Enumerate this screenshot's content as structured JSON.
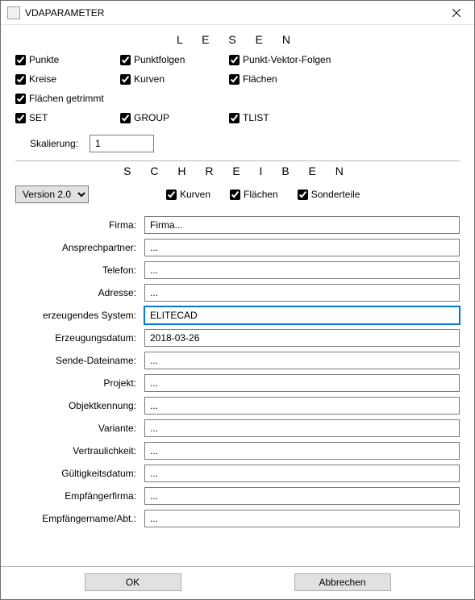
{
  "window": {
    "title": "VDAPARAMETER"
  },
  "read": {
    "heading": "L E S E N",
    "punkte": "Punkte",
    "punktfolgen": "Punktfolgen",
    "punkt_vektor_folgen": "Punkt-Vektor-Folgen",
    "kreise": "Kreise",
    "kurven": "Kurven",
    "flaechen": "Flächen",
    "flaechen_getrimmt": "Flächen getrimmt",
    "set": "SET",
    "group": "GROUP",
    "tlist": "TLIST",
    "skalierung_label": "Skalierung:",
    "skalierung_value": "1"
  },
  "write": {
    "heading": "S C H R E I B E N",
    "version_selected": "Version 2.0",
    "kurven": "Kurven",
    "flaechen": "Flächen",
    "sonderteile": "Sonderteile",
    "fields": {
      "firma": {
        "label": "Firma:",
        "value": "Firma..."
      },
      "ansprechpartner": {
        "label": "Ansprechpartner:",
        "value": "..."
      },
      "telefon": {
        "label": "Telefon:",
        "value": "..."
      },
      "adresse": {
        "label": "Adresse:",
        "value": "..."
      },
      "erz_system": {
        "label": "erzeugendes System:",
        "value": "ELITECAD"
      },
      "erz_datum": {
        "label": "Erzeugungsdatum:",
        "value": "2018-03-26"
      },
      "sende_dateiname": {
        "label": "Sende-Dateiname:",
        "value": "..."
      },
      "projekt": {
        "label": "Projekt:",
        "value": "..."
      },
      "objektkennung": {
        "label": "Objektkennung:",
        "value": "..."
      },
      "variante": {
        "label": "Variante:",
        "value": "..."
      },
      "vertraulichkeit": {
        "label": "Vertraulichkeit:",
        "value": "..."
      },
      "gueltigkeitsdatum": {
        "label": "Gültigkeitsdatum:",
        "value": "..."
      },
      "empf_firma": {
        "label": "Empfängerfirma:",
        "value": "..."
      },
      "empf_name": {
        "label": "Empfängername/Abt.:",
        "value": "..."
      }
    }
  },
  "buttons": {
    "ok": "OK",
    "cancel": "Abbrechen"
  }
}
